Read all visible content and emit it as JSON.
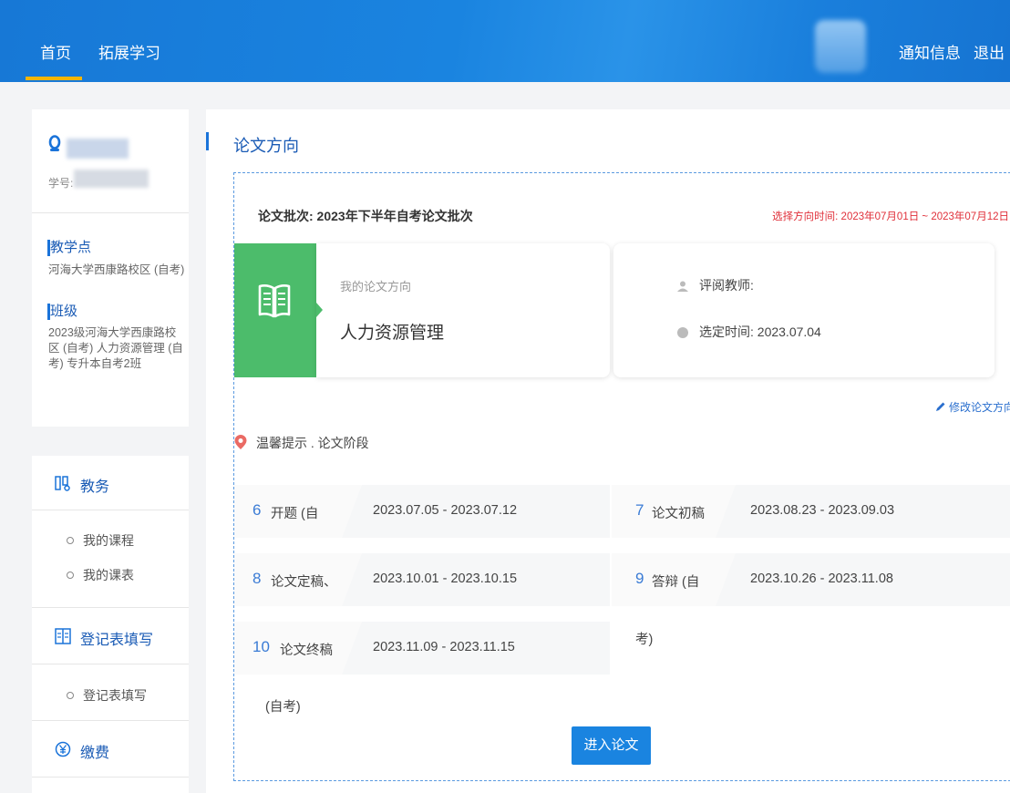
{
  "topnav": {
    "home": "首页",
    "extended_learning": "拓展学习",
    "notifications": "通知信息",
    "logout": "退出"
  },
  "profile": {
    "student_id_label": "学号:",
    "teaching_point_title": "教学点",
    "teaching_point_value": "河海大学西康路校区 (自考)",
    "class_title": "班级",
    "class_value": "2023级河海大学西康路校区 (自考) 人力资源管理 (自考) 专升本自考2班"
  },
  "menu": {
    "academic": "教务",
    "my_courses": "我的课程",
    "my_schedule": "我的课表",
    "registration_form": "登记表填写",
    "registration_form_sub": "登记表填写",
    "payment": "缴费"
  },
  "main": {
    "title": "论文方向",
    "batch_label": "论文批次: 2023年下半年自考论文批次",
    "select_time": "选择方向时间: 2023年07月01日 ~ 2023年07月12日",
    "my_direction_caption": "我的论文方向",
    "my_direction_value": "人力资源管理",
    "reviewer_label": "评阅教师:",
    "selected_time_label": "选定时间: 2023.07.04",
    "edit_link": "修改论文方向",
    "tip": "温馨提示 . 论文阶段",
    "stages": [
      {
        "num": "6",
        "name": "开题 (自",
        "dates": "2023.07.05 - 2023.07.12"
      },
      {
        "num": "7",
        "name": "论文初稿",
        "dates": "2023.08.23 - 2023.09.03"
      },
      {
        "num": "8",
        "name": "论文定稿、",
        "dates": "2023.10.01 - 2023.10.15"
      },
      {
        "num": "9",
        "name": "答辩 (自",
        "dates": "2023.10.26 - 2023.11.08"
      },
      {
        "num": "10",
        "name": "论文终稿",
        "dates": "2023.11.09 - 2023.11.15"
      }
    ],
    "wrap_kao": "考)",
    "wrap_zikao": "(自考)",
    "enter_button": "进入论文"
  },
  "colors": {
    "topbar": "#1a84e0",
    "accent_green": "#4cbc6b",
    "highlight_red": "#e0303a",
    "link_blue": "#1a5bb5"
  },
  "icons": [
    "user-icon",
    "book-icon",
    "person-icon",
    "clock-icon",
    "pencil-icon",
    "location-pin-icon",
    "academic-icon",
    "form-icon",
    "yen-icon"
  ]
}
